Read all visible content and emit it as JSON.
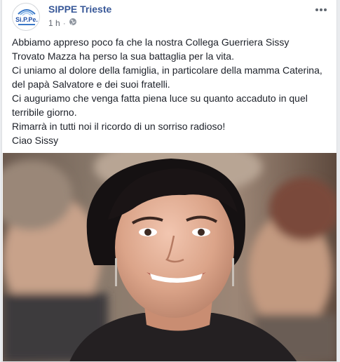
{
  "post": {
    "page_name": "SIPPE Trieste",
    "timestamp": "1 h",
    "separator": "·",
    "audience_icon": "globe-icon",
    "more_icon": "ellipsis-icon",
    "avatar_text": "Si.P.Pe.",
    "body": [
      "Abbiamo appreso poco fa che la nostra Collega Guerriera Sissy",
      "Trovato Mazza ha perso la sua battaglia per la vita.",
      "Ci uniamo al dolore della famiglia, in particolare della mamma Caterina,",
      "del papà Salvatore e dei suoi fratelli.",
      "Ci auguriamo che venga fatta piena luce su quanto accaduto in quel",
      "terribile giorno.",
      "Rimarrà in tutti noi il ricordo di un sorriso radioso!",
      "Ciao Sissy"
    ]
  },
  "colors": {
    "link": "#385898",
    "text": "#1d2129",
    "meta": "#616770",
    "brand_blue": "#1f4fa8"
  }
}
